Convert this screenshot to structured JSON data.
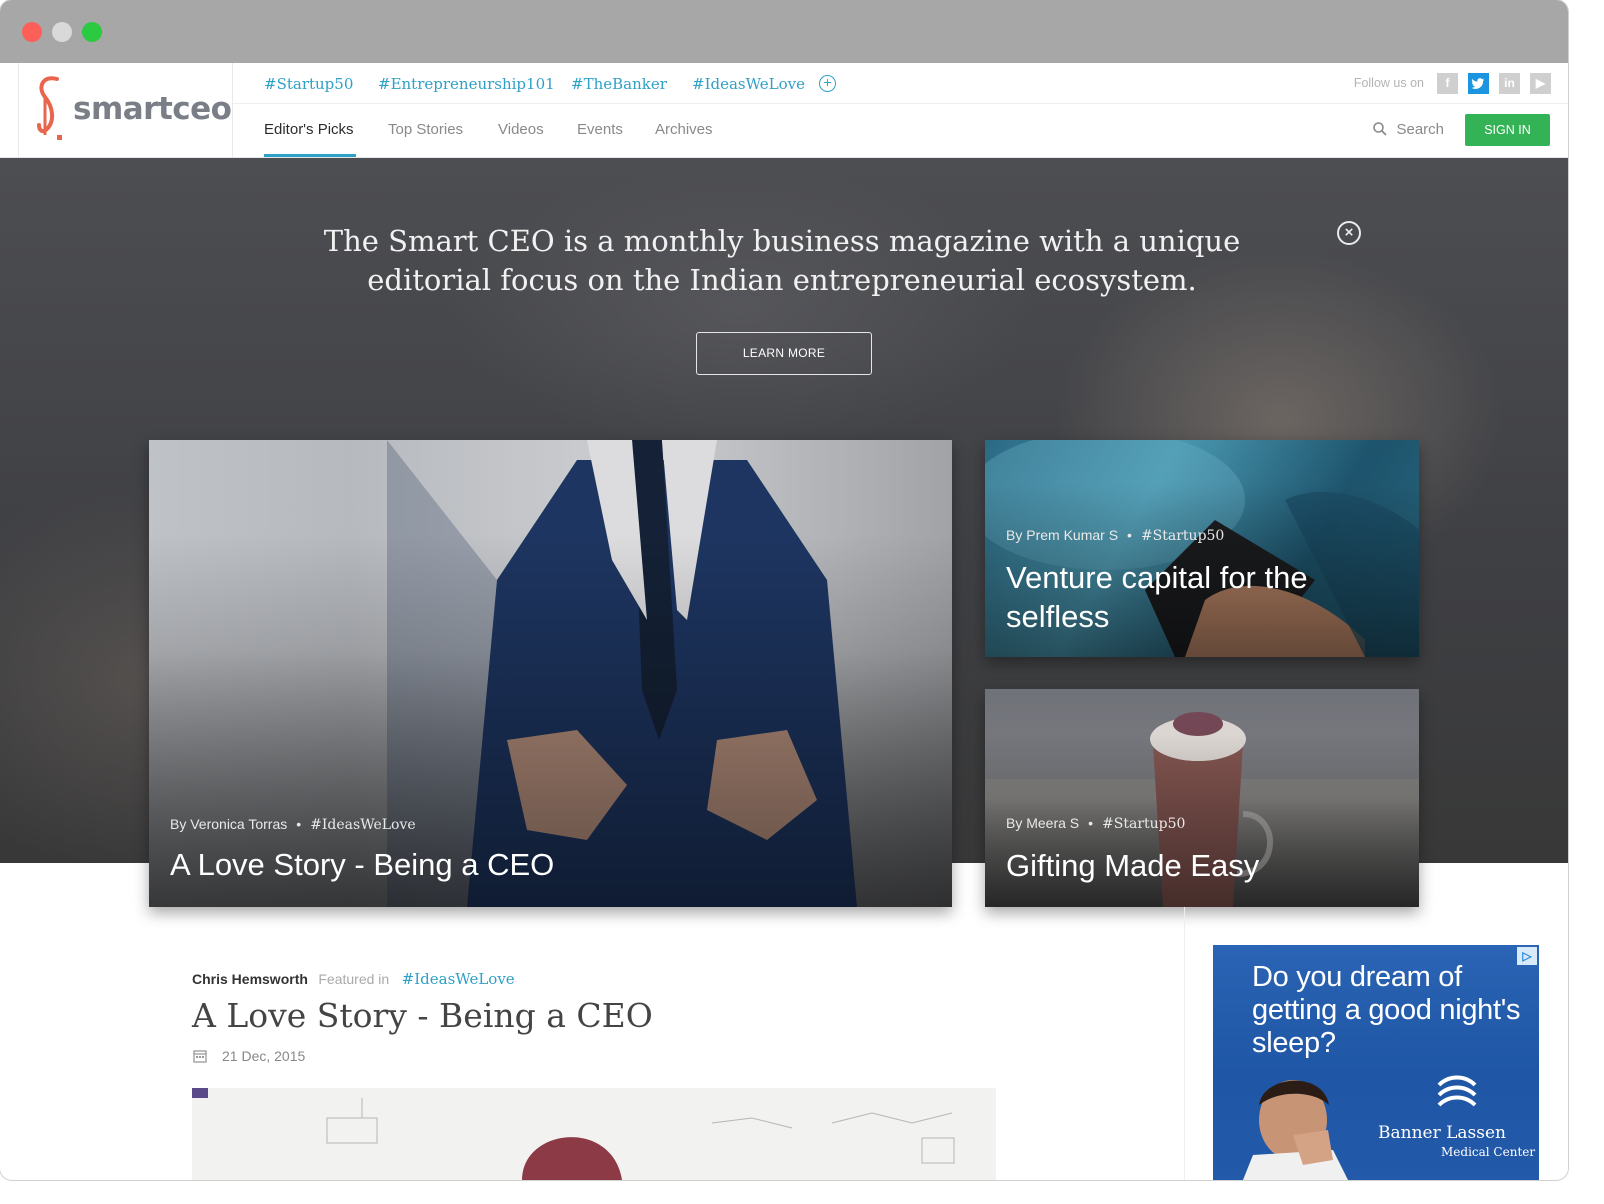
{
  "brand": {
    "logo_text": "smartceo"
  },
  "tags": [
    "#Startup50",
    "#Entrepreneurship101",
    "#TheBanker",
    "#IdeasWeLove"
  ],
  "header": {
    "follow_label": "Follow us on",
    "social": [
      "facebook-icon",
      "twitter-icon",
      "linkedin-icon",
      "youtube-icon"
    ],
    "nav": [
      "Editor's Picks",
      "Top Stories",
      "Videos",
      "Events",
      "Archives"
    ],
    "active_nav": "Editor's Picks",
    "search_label": "Search",
    "signin_label": "SIGN IN"
  },
  "hero": {
    "text": "The Smart CEO is a monthly business magazine with a unique editorial focus on the Indian entrepreneurial ecosystem.",
    "button": "LEARN MORE"
  },
  "cards": [
    {
      "author": "By Veronica Torras",
      "tag": "#IdeasWeLove",
      "title": "A Love Story - Being a CEO"
    },
    {
      "author": "By Prem Kumar S",
      "tag": "#Startup50",
      "title": "Venture capital for the selfless"
    },
    {
      "author": "By Meera S",
      "tag": "#Startup50",
      "title": "Gifting Made Easy"
    }
  ],
  "article": {
    "author": "Chris Hemsworth",
    "featured_label": "Featured in",
    "tag": "#IdeasWeLove",
    "title": "A Love Story - Being a CEO",
    "date": "21 Dec, 2015"
  },
  "ad": {
    "headline": "Do you dream of getting a good night's sleep?",
    "brand": "Banner Lassen",
    "brand_sub": "Medical Center"
  },
  "colors": {
    "accent": "#2fa0c7",
    "signin": "#34b356",
    "logo": "#e8664d"
  }
}
